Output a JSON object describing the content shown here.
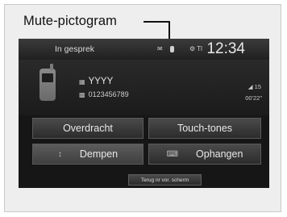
{
  "callout": {
    "label": "Mute-pictogram"
  },
  "status_bar": {
    "title": "In gesprek",
    "icons_text": "✉",
    "signal_text": "⚙ Tl",
    "clock": "12:34"
  },
  "call": {
    "contact_name": "YYYY",
    "contact_number": "0123456789",
    "signal_strength": "15",
    "duration": "00'22\""
  },
  "buttons": {
    "transfer": "Overdracht",
    "touch_tones": "Touch-tones",
    "mute": "Dempen",
    "hang_up": "Ophangen",
    "back": "Terug nr vor. scherm"
  },
  "colors": {
    "screen_bg": "#161616",
    "button_bg": "#3a3a3a",
    "text": "#e8e8e8"
  }
}
